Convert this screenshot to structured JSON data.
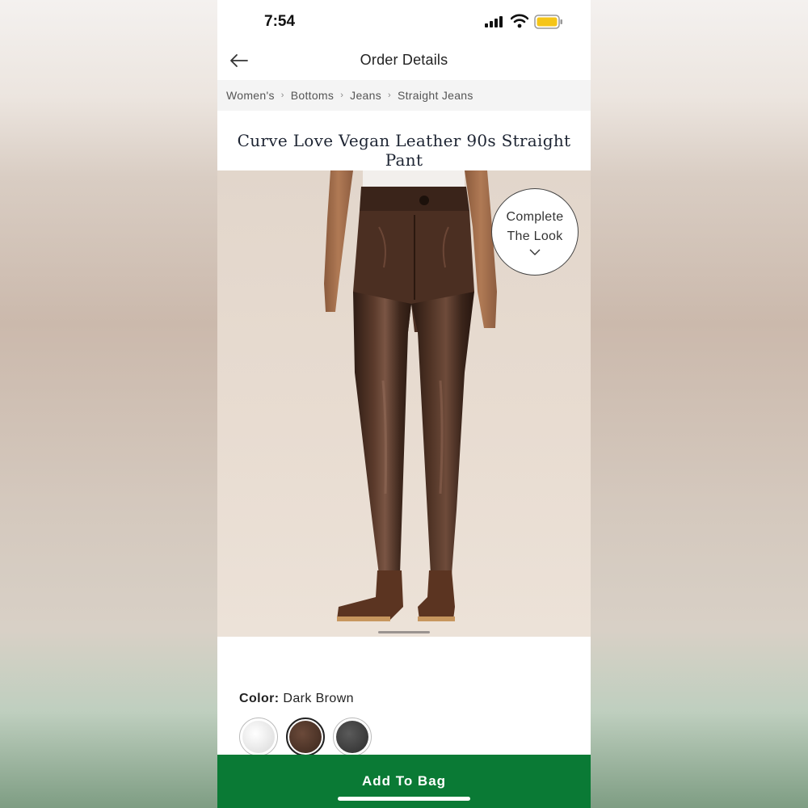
{
  "status_bar": {
    "time": "7:54",
    "icons": [
      "signal-icon",
      "wifi-icon",
      "battery-icon"
    ],
    "battery_color": "#f5c518"
  },
  "header": {
    "title": "Order Details",
    "back_icon": "back-arrow-icon"
  },
  "breadcrumb": [
    "Women's",
    "Bottoms",
    "Jeans",
    "Straight Jeans"
  ],
  "product": {
    "title": "Curve Love Vegan Leather 90s Straight Pant",
    "complete_look": {
      "line1": "Complete",
      "line2": "The Look",
      "icon": "chevron-down-icon"
    },
    "color": {
      "label": "Color:",
      "value": "Dark Brown",
      "swatches": [
        {
          "name": "white",
          "color": "#e9e9e9"
        },
        {
          "name": "dark-brown",
          "color": "#4a3428",
          "selected": true
        },
        {
          "name": "black",
          "color": "#3a3a3a"
        }
      ]
    }
  },
  "actions": {
    "add_to_bag": "Add To Bag"
  },
  "colors": {
    "accent_green": "#0a7a35",
    "pant_brown": "#4a2e22"
  }
}
